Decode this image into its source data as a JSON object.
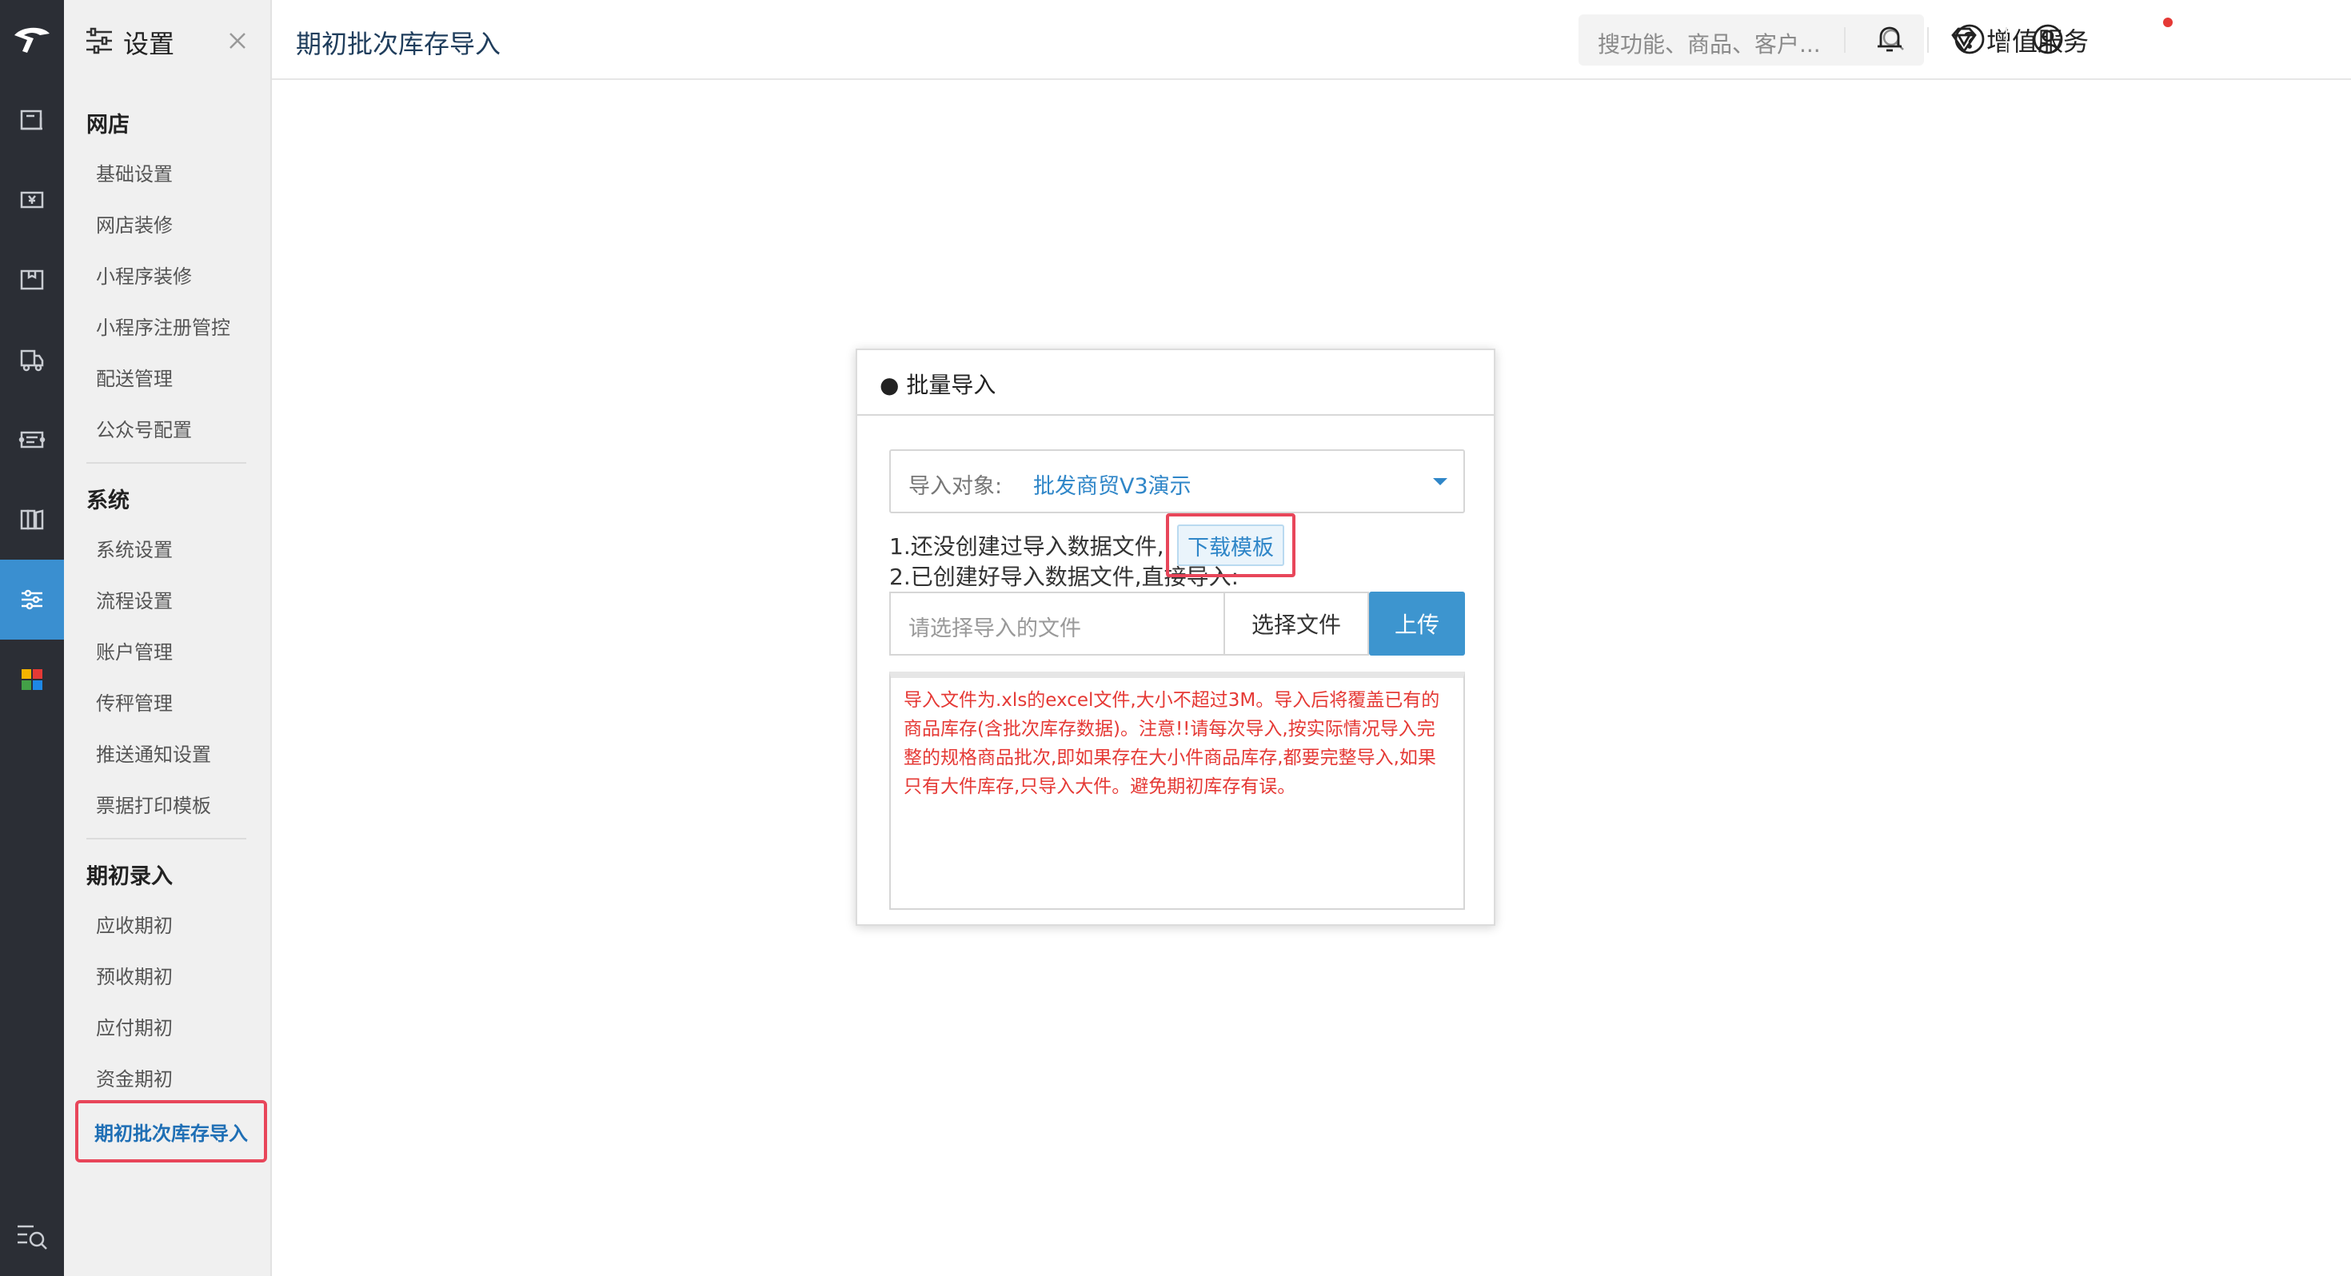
{
  "colors": {
    "rail_bg": "#2b2e35",
    "accent": "#3a8fd0",
    "panel_bg": "#f0f0f0",
    "highlight_red": "#e8465a",
    "note_red": "#e53935"
  },
  "rail": {
    "icons": [
      "logo-icon",
      "store-icon",
      "cash-icon",
      "box-icon",
      "truck-icon",
      "ticket-icon",
      "report-icon",
      "settings-sliders-icon",
      "apps-grid-icon",
      "menu-search-icon"
    ],
    "active": "settings-sliders-icon"
  },
  "panel": {
    "title": "设置",
    "groups": [
      {
        "title": "网店",
        "items": [
          "基础设置",
          "网店装修",
          "小程序装修",
          "小程序注册管控",
          "配送管理",
          "公众号配置"
        ]
      },
      {
        "title": "系统",
        "items": [
          "系统设置",
          "流程设置",
          "账户管理",
          "传秤管理",
          "推送通知设置",
          "票据打印模板"
        ]
      },
      {
        "title": "期初录入",
        "items": [
          "应收期初",
          "预收期初",
          "应付期初",
          "资金期初",
          "期初批次库存导入"
        ]
      }
    ],
    "current_item": "期初批次库存导入"
  },
  "header": {
    "title": "期初批次库存导入",
    "search_placeholder": "搜功能、商品、客户...",
    "value_service": "增值服务"
  },
  "card": {
    "title": "● 批量导入",
    "select_label": "导入对象:",
    "select_value": "批发商贸V3演示",
    "step1": "1.还没创建过导入数据文件,",
    "download_template": "下载模板",
    "step2": "2.已创建好导入数据文件,直接导入:",
    "file_placeholder": "请选择导入的文件",
    "choose_file": "选择文件",
    "upload": "上传",
    "note": "导入文件为.xls的excel文件,大小不超过3M。导入后将覆盖已有的商品库存(含批次库存数据)。注意!!请每次导入,按实际情况导入完整的规格商品批次,即如果存在大小件商品库存,都要完整导入,如果只有大件库存,只导入大件。避免期初库存有误。"
  }
}
